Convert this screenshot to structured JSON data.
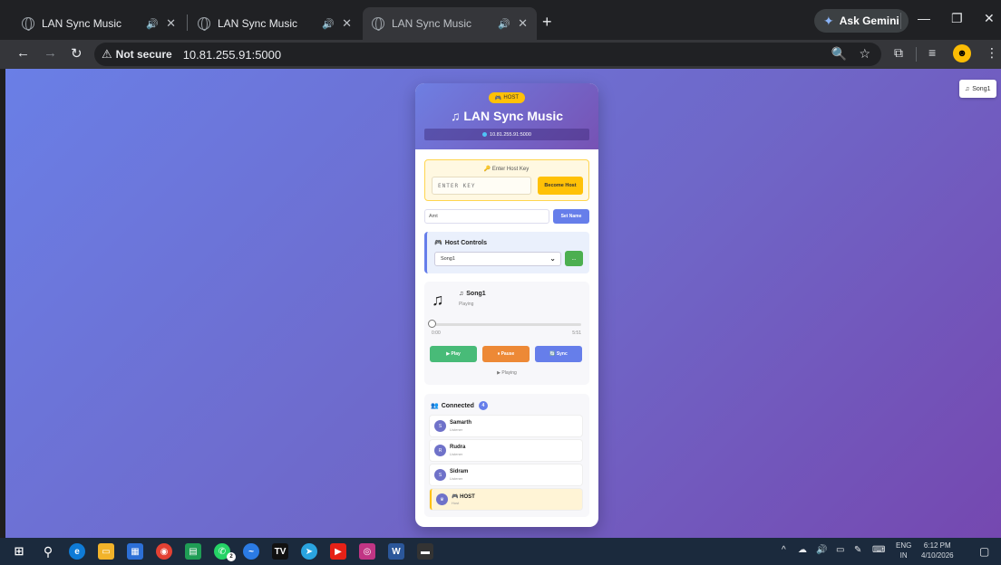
{
  "browser": {
    "tabs": [
      {
        "title": "LAN Sync Music",
        "audio": "🔊",
        "close": "✕"
      },
      {
        "title": "LAN Sync Music",
        "audio": "🔊",
        "close": "✕"
      },
      {
        "title": "LAN Sync Music",
        "audio": "🔊",
        "close": "✕"
      }
    ],
    "new_tab": "+",
    "gemini_label": "Ask Gemini",
    "security_warning": "Not secure",
    "url": "10.81.255.91:5000"
  },
  "page": {
    "now_playing_chip": "Song1",
    "role_badge": "HOST",
    "app_title": "LAN Sync Music",
    "server_address": "10.81.255.91:5000",
    "host_key": {
      "label": "Enter Host Key",
      "placeholder": "ENTER KEY",
      "button": "Become Host"
    },
    "name_input": {
      "value": "Amt",
      "button": "Set Name"
    },
    "host_controls": {
      "title": "Host Controls",
      "selected_song": "Song1",
      "go_button": "..."
    },
    "player": {
      "song_title": "Song1",
      "status": "Playing",
      "elapsed": "0:00",
      "duration": "5:51",
      "progress": 0.0,
      "play_label": "▶ Play",
      "pause_label": "⏸ Pause",
      "sync_label": "🔄 Sync",
      "state_text": "▶ Playing"
    },
    "connected": {
      "title": "Connected",
      "count": "4",
      "users": [
        {
          "initial": "S",
          "name": "Samarth",
          "role": "Listener"
        },
        {
          "initial": "R",
          "name": "Rudra",
          "role": "Listener"
        },
        {
          "initial": "S",
          "name": "Sidram",
          "role": "Listener"
        },
        {
          "initial": "♛",
          "name": "HOST",
          "role": "Host"
        }
      ]
    }
  },
  "taskbar": {
    "lang_top": "ENG",
    "lang_bottom": "IN",
    "time": "6:12 PM",
    "date": "4/10/2026",
    "whatsapp_badge": "2"
  },
  "colors": {
    "accent": "#667eea",
    "host_yellow": "#ffc107",
    "play_green": "#48bb78",
    "pause_orange": "#ed8936"
  }
}
